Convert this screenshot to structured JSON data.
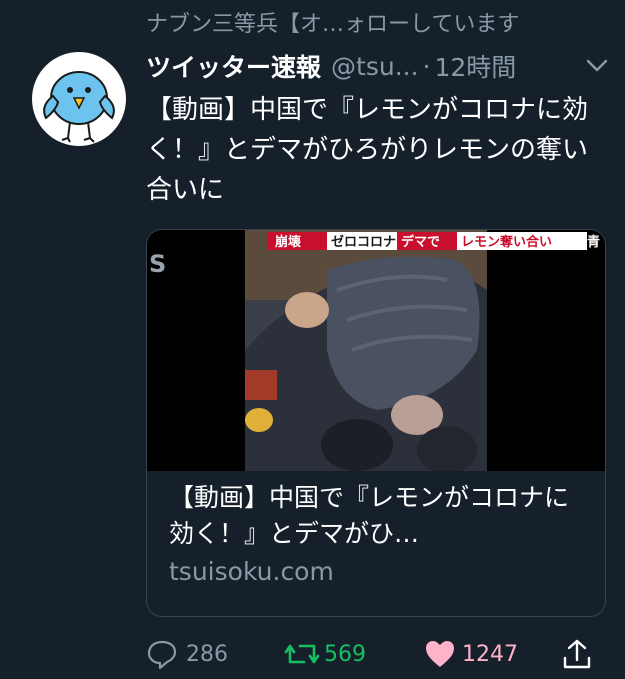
{
  "social_context": "ナブン三等兵【オ…ォローしています",
  "tweet": {
    "display_name": "ツイッター速報",
    "handle": "@tsu...",
    "separator": "·",
    "timestamp": "12時間",
    "text": "【動画】中国で『レモンがコロナに効く！』とデマがひろがりレモンの奪い合いに"
  },
  "card": {
    "media_caption": {
      "tag1": "崩壊",
      "tag2": "ゼロコロナ",
      "tag3": "デマで",
      "tag4": "レモン奪い合い",
      "tag5": "青"
    },
    "title": "【動画】中国で『レモンがコロナに効く！』とデマがひ…",
    "domain": "tsuisoku.com"
  },
  "actions": {
    "replies": "286",
    "retweets": "569",
    "likes": "1247"
  },
  "colors": {
    "background": "#15202b",
    "secondary_text": "#8899a6",
    "retweet_green": "#17bf63",
    "like_pink": "#ffb3c8",
    "card_border": "#38444d"
  },
  "icons": [
    "chevron-down-icon",
    "reply-icon",
    "retweet-icon",
    "heart-icon",
    "share-icon"
  ]
}
